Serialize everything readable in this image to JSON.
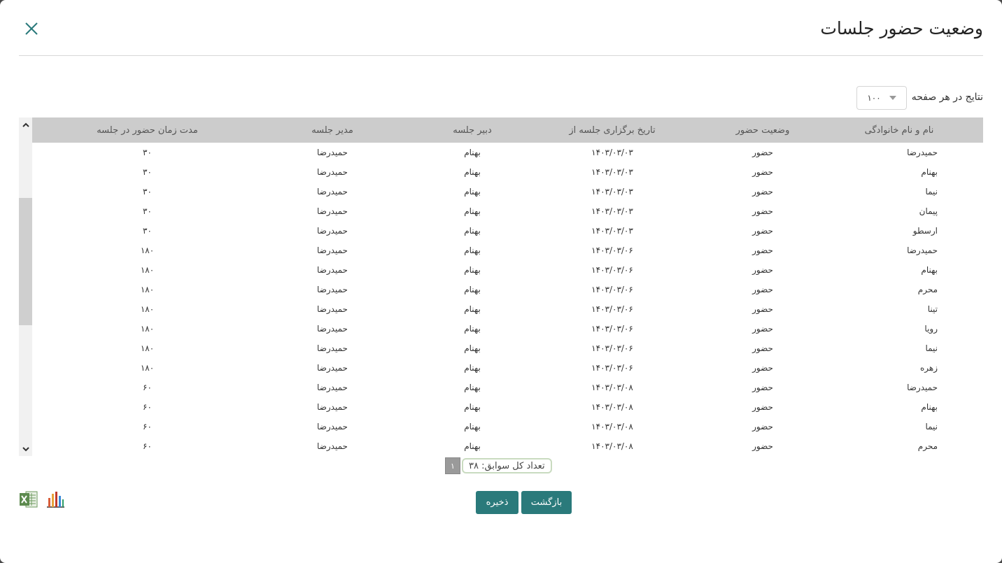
{
  "dialog": {
    "title": "وضعیت حضور جلسات"
  },
  "page_size": {
    "label": "نتایج در هر صفحه",
    "value": "۱۰۰"
  },
  "table": {
    "headers": [
      "نام و نام خانوادگی",
      "وضعیت حضور",
      "تاریخ برگزاری جلسه از",
      "دبیر جلسه",
      "مدیر جلسه",
      "مدت زمان حضور در جلسه"
    ],
    "rows": [
      [
        "حمیدرضا",
        "حضور",
        "۱۴۰۳/۰۳/۰۳",
        "بهنام",
        "حمیدرضا",
        "۳۰"
      ],
      [
        "بهنام",
        "حضور",
        "۱۴۰۳/۰۳/۰۳",
        "بهنام",
        "حمیدرضا",
        "۳۰"
      ],
      [
        "نیما",
        "حضور",
        "۱۴۰۳/۰۳/۰۳",
        "بهنام",
        "حمیدرضا",
        "۳۰"
      ],
      [
        "پیمان",
        "حضور",
        "۱۴۰۳/۰۳/۰۳",
        "بهنام",
        "حمیدرضا",
        "۳۰"
      ],
      [
        "ارسطو",
        "حضور",
        "۱۴۰۳/۰۳/۰۳",
        "بهنام",
        "حمیدرضا",
        "۳۰"
      ],
      [
        "حمیدرضا",
        "حضور",
        "۱۴۰۳/۰۳/۰۶",
        "بهنام",
        "حمیدرضا",
        "۱۸۰"
      ],
      [
        "بهنام",
        "حضور",
        "۱۴۰۳/۰۳/۰۶",
        "بهنام",
        "حمیدرضا",
        "۱۸۰"
      ],
      [
        "محرم",
        "حضور",
        "۱۴۰۳/۰۳/۰۶",
        "بهنام",
        "حمیدرضا",
        "۱۸۰"
      ],
      [
        "تینا",
        "حضور",
        "۱۴۰۳/۰۳/۰۶",
        "بهنام",
        "حمیدرضا",
        "۱۸۰"
      ],
      [
        "رویا",
        "حضور",
        "۱۴۰۳/۰۳/۰۶",
        "بهنام",
        "حمیدرضا",
        "۱۸۰"
      ],
      [
        "نیما",
        "حضور",
        "۱۴۰۳/۰۳/۰۶",
        "بهنام",
        "حمیدرضا",
        "۱۸۰"
      ],
      [
        "زهره",
        "حضور",
        "۱۴۰۳/۰۳/۰۶",
        "بهنام",
        "حمیدرضا",
        "۱۸۰"
      ],
      [
        "حمیدرضا",
        "حضور",
        "۱۴۰۳/۰۳/۰۸",
        "بهنام",
        "حمیدرضا",
        "۶۰"
      ],
      [
        "بهنام",
        "حضور",
        "۱۴۰۳/۰۳/۰۸",
        "بهنام",
        "حمیدرضا",
        "۶۰"
      ],
      [
        "نیما",
        "حضور",
        "۱۴۰۳/۰۳/۰۸",
        "بهنام",
        "حمیدرضا",
        "۶۰"
      ],
      [
        "محرم",
        "حضور",
        "۱۴۰۳/۰۳/۰۸",
        "بهنام",
        "حمیدرضا",
        "۶۰"
      ]
    ]
  },
  "pager": {
    "current_page": "۱",
    "total_records": "تعداد کل سوابق: ۳۸"
  },
  "buttons": {
    "save": "ذخیره",
    "back": "بازگشت"
  },
  "icons": {
    "close": "close-icon",
    "excel": "excel-export-icon",
    "chart": "bar-chart-icon",
    "scroll_up": "chevron-up-icon",
    "scroll_down": "chevron-down-icon",
    "dropdown": "caret-down-icon"
  },
  "colors": {
    "primary_button": "#2a7a7b",
    "header_bg": "#cccccc",
    "close_icon": "#2a7a7b",
    "pager_bg": "#9a9a9a"
  }
}
